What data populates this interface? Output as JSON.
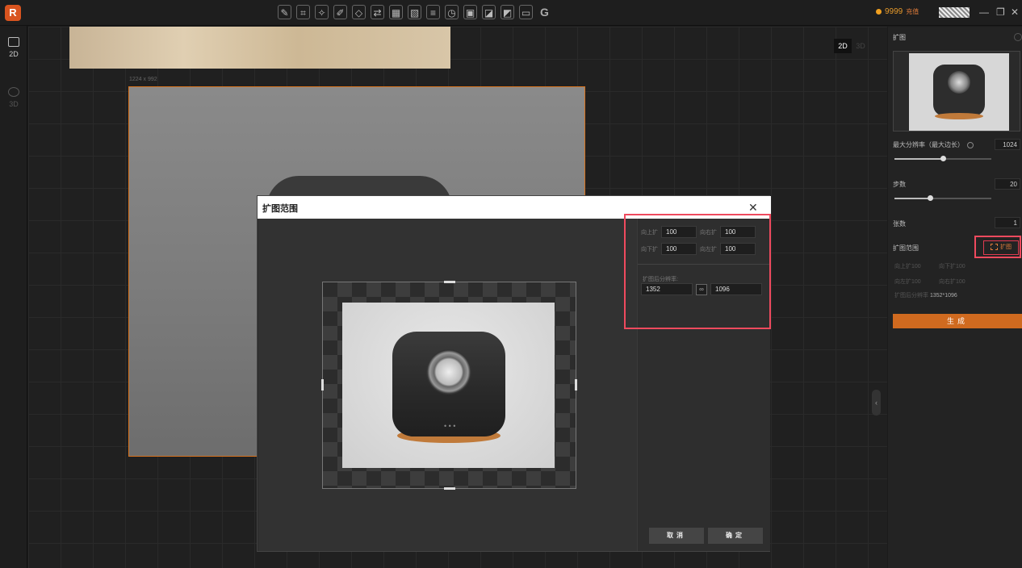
{
  "topbar": {
    "tool_icons": [
      "edit-icon",
      "scan-icon",
      "magic-icon",
      "brush-icon",
      "eraser-icon",
      "swap-icon",
      "texture-icon",
      "stripe-icon",
      "bridge-icon",
      "timer-icon",
      "square-icon",
      "expand-icon",
      "chart-icon",
      "hd-icon"
    ],
    "credits": "9999",
    "charge_label": "充值",
    "g_label": "G"
  },
  "leftbar": {
    "items": [
      "2D",
      "3D"
    ]
  },
  "canvas": {
    "dim_label": "1224 x 992",
    "mode_2d": "2D",
    "mode_3d": "3D"
  },
  "right_panel": {
    "title": "扩图",
    "max_resolution_label": "最大分辨率（最大边长）",
    "max_resolution_value": "1024",
    "max_resolution_fraction": 0.5,
    "steps_label": "步数",
    "steps_value": "20",
    "steps_fraction": 0.37,
    "count_label": "张数",
    "count_value": "1",
    "range_label": "扩图范围",
    "expand_button": "扩图",
    "summary_up": "向上扩100",
    "summary_down": "向下扩100",
    "summary_left": "向左扩100",
    "summary_right": "向右扩100",
    "summary_res_label": "扩图后分辨率",
    "summary_res_value": "1352*1096",
    "generate": "生成"
  },
  "dialog": {
    "title": "扩图范围",
    "up_label": "向上扩",
    "up_value": "100",
    "right_label": "向右扩",
    "right_value": "100",
    "down_label": "向下扩",
    "down_value": "100",
    "left_label": "向左扩",
    "left_value": "100",
    "resolution_label": "扩图后分辨率:",
    "width_value": "1352",
    "height_value": "1096",
    "cancel": "取消",
    "confirm": "确定"
  }
}
